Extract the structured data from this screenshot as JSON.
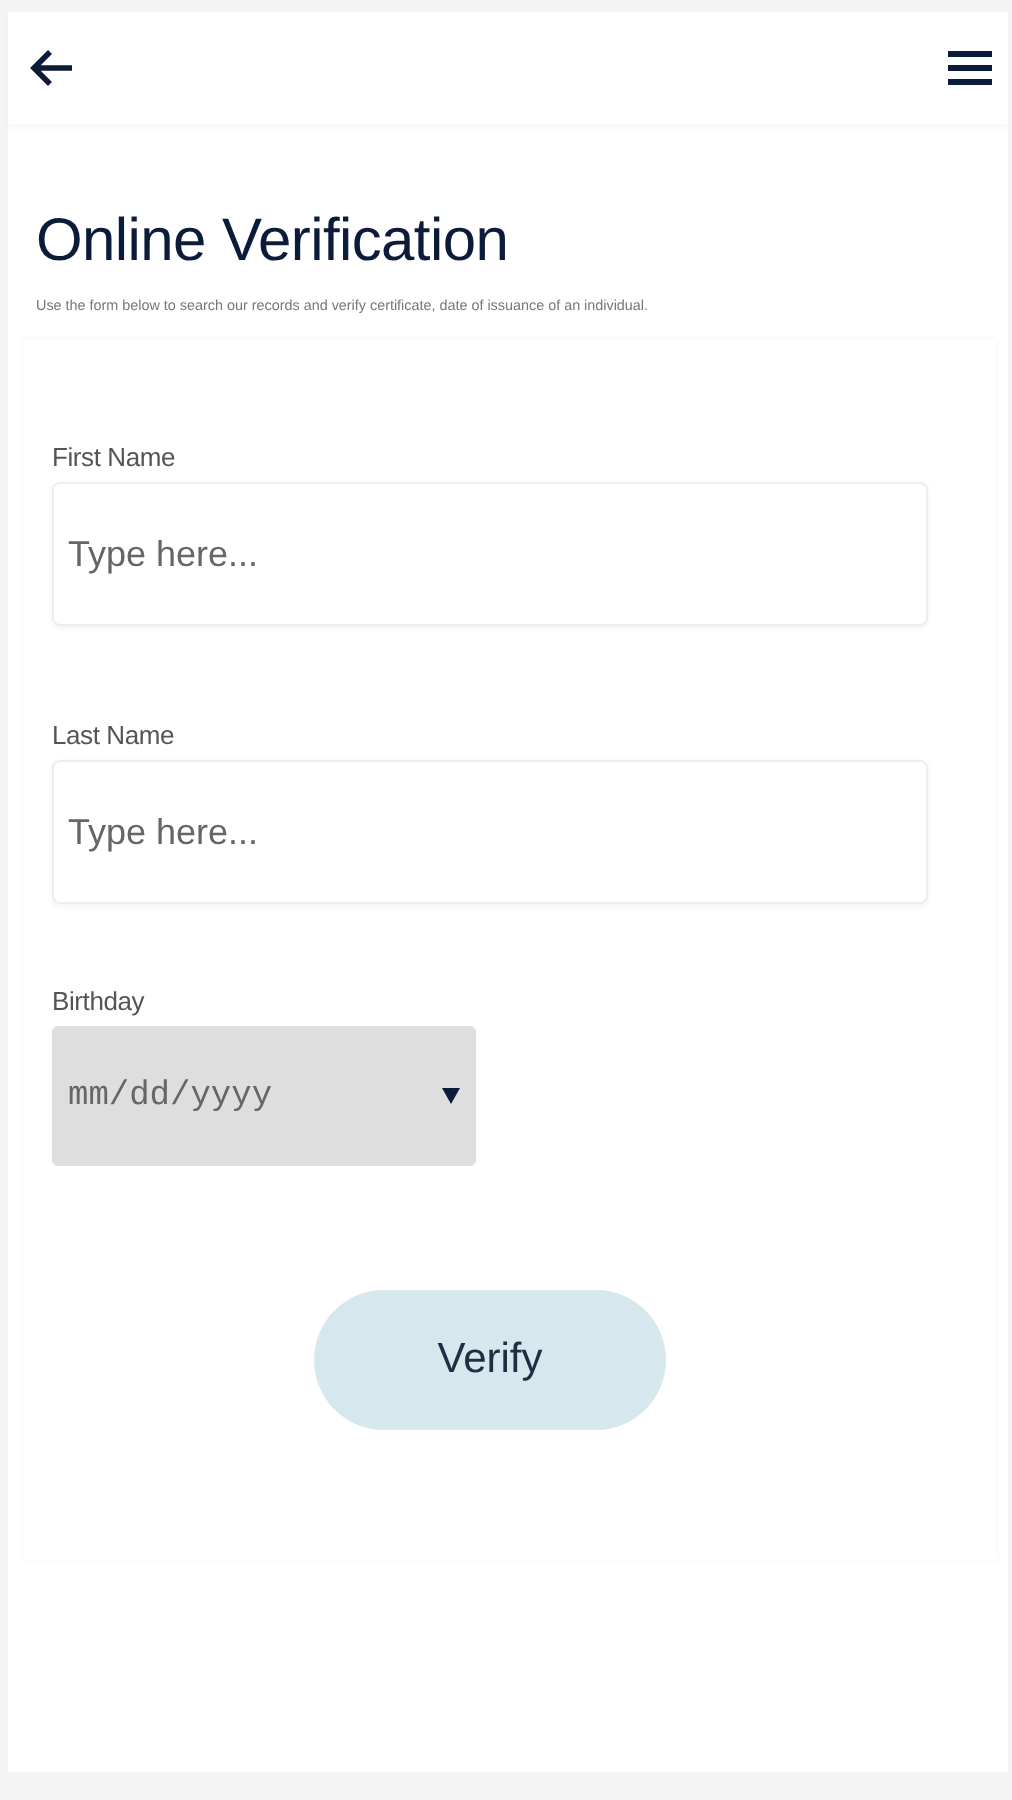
{
  "title": "Online Verification",
  "description": "Use the form below to search our records and verify certificate, date of issuance of an individual.",
  "fields": [
    {
      "kind": "text",
      "label": "First Name",
      "placeholder": "Type here..."
    },
    {
      "kind": "text",
      "label": "Last Name",
      "placeholder": "Type here..."
    },
    {
      "kind": "date",
      "label": "Birthday",
      "placeholder": "mm/dd/yyyy"
    }
  ],
  "submit_button": "Verify"
}
